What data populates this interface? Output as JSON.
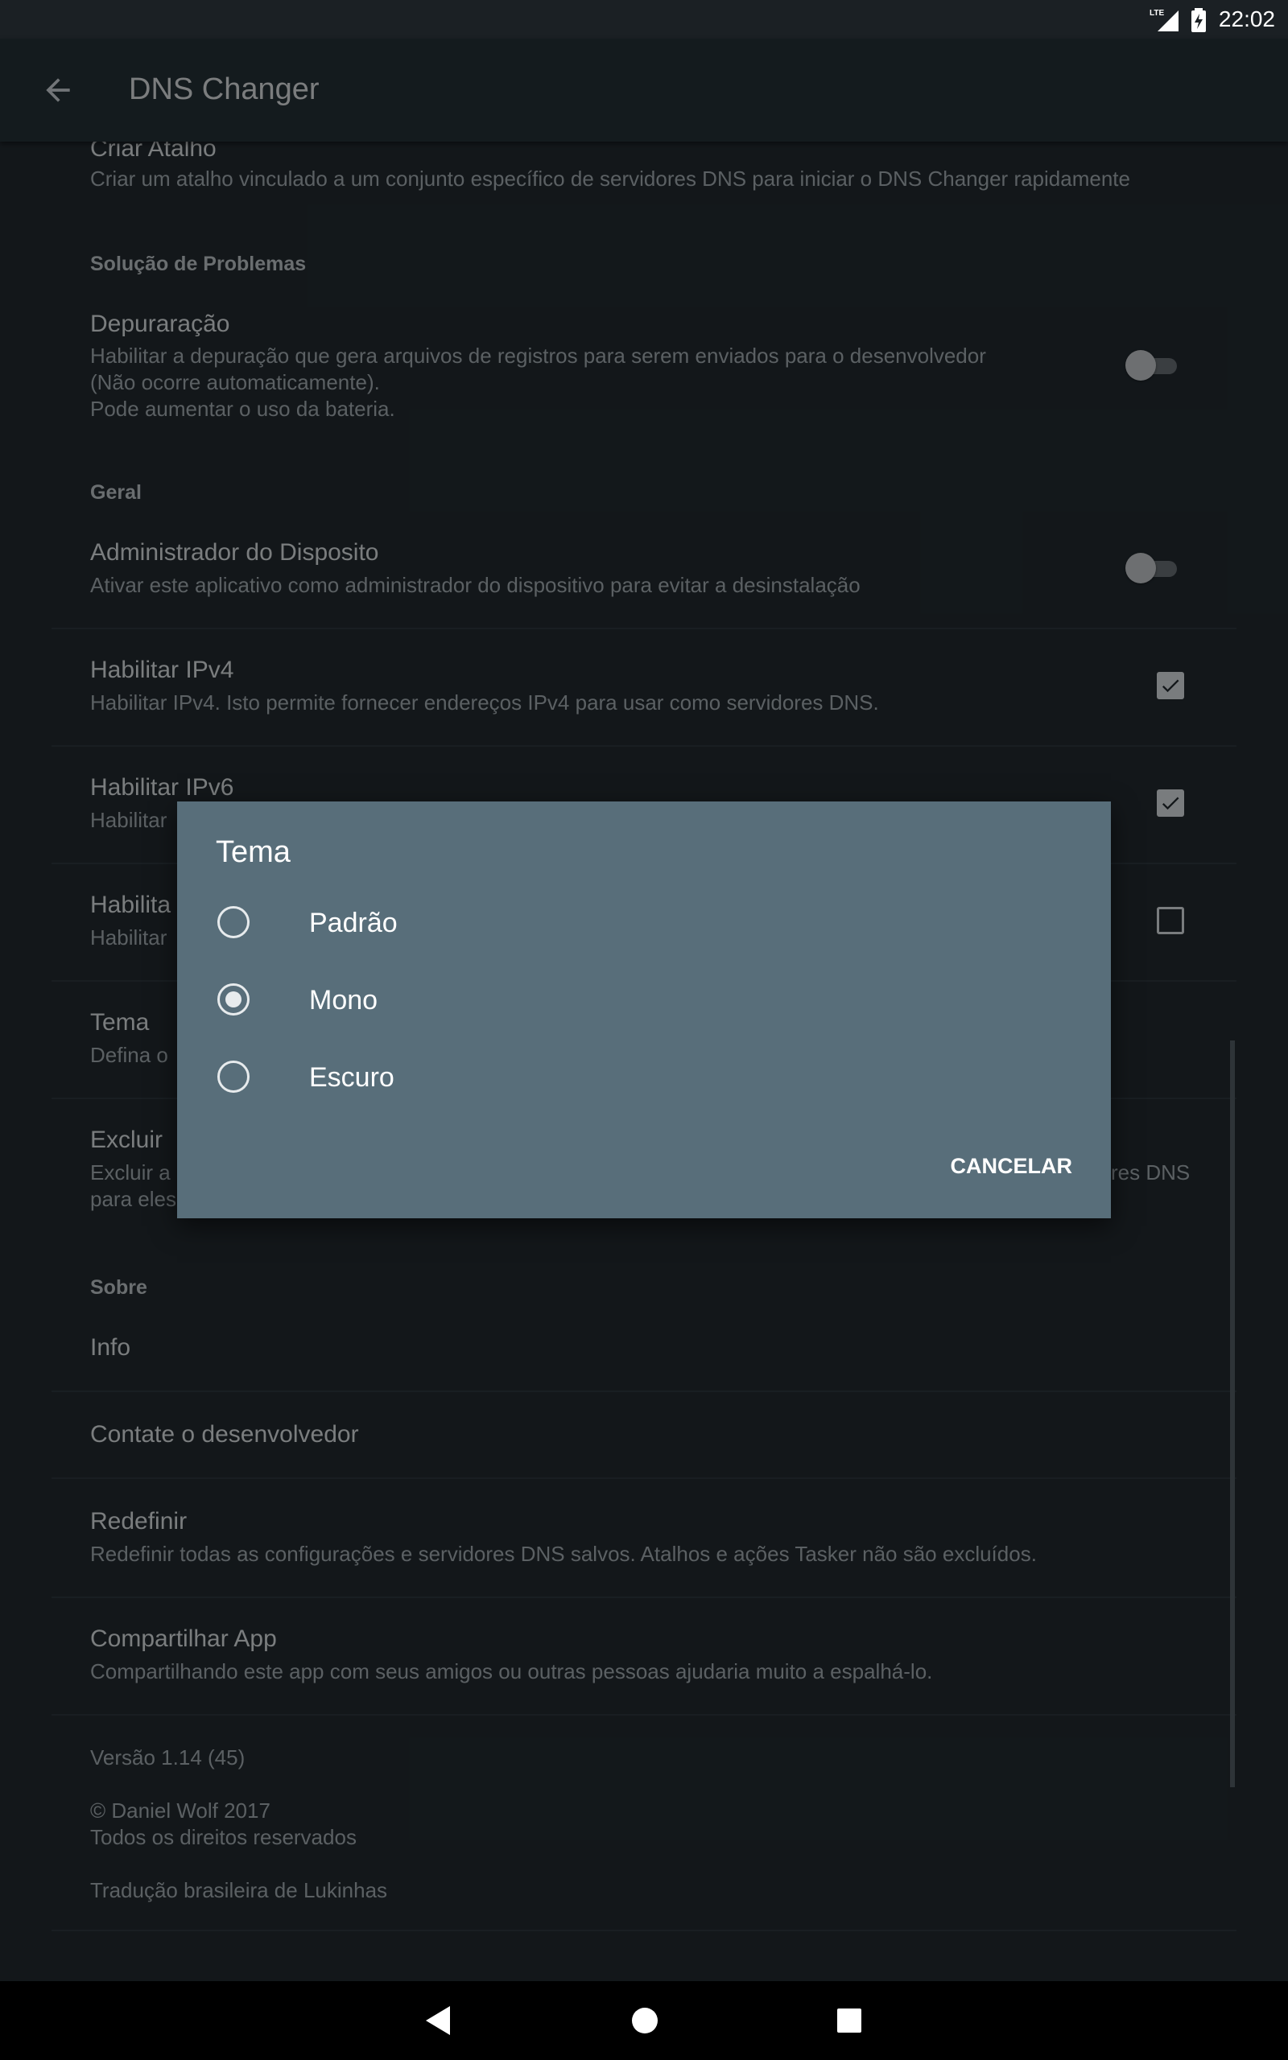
{
  "status_bar": {
    "time": "22:02",
    "network": "LTE"
  },
  "app_bar": {
    "title": "DNS Changer"
  },
  "settings": {
    "shortcut": {
      "title": "Criar Atalho",
      "summary": "Criar um atalho vinculado a um conjunto específico de servidores DNS para iniciar o DNS Changer rapidamente"
    },
    "troubleshooting_header": "Solução de Problemas",
    "debug": {
      "title": "Depuraração",
      "summary": [
        "Habilitar a depuração que gera arquivos de registros para serem enviados para o desenvolvedor",
        "(Não ocorre automaticamente).",
        "Pode aumentar o uso da bateria."
      ],
      "enabled": false
    },
    "general_header": "Geral",
    "device_admin": {
      "title": "Administrador do Disposito",
      "summary": "Ativar este aplicativo como administrador do dispositivo para evitar a desinstalação",
      "enabled": false
    },
    "ipv4": {
      "title": "Habilitar IPv4",
      "summary": "Habilitar IPv4. Isto permite fornecer endereços IPv4 para usar como servidores DNS.",
      "checked": true
    },
    "ipv6": {
      "title": "Habilitar IPv6",
      "summary": "Habilitar",
      "checked": true
    },
    "item3": {
      "title": "Habilita",
      "summary": "Habilitar",
      "checked": false
    },
    "theme": {
      "title": "Tema",
      "summary": "Defina o"
    },
    "exclude": {
      "title": "Excluir",
      "summary": [
        "Excluir a",
        "para eles"
      ],
      "summary_right": "res DNS"
    },
    "about_header": "Sobre",
    "info": {
      "title": "Info"
    },
    "contact": {
      "title": "Contate o desenvolvedor"
    },
    "reset": {
      "title": "Redefinir",
      "summary": "Redefinir todas as configurações e servidores DNS salvos. Atalhos e ações Tasker não são excluídos."
    },
    "share": {
      "title": "Compartilhar App",
      "summary": "Compartilhando este app com seus amigos ou outras pessoas ajudaria muito a espalhá-lo."
    },
    "footer": {
      "version": "Versão 1.14 (45)",
      "copyright": "© Daniel Wolf 2017",
      "rights": "Todos os direitos reservados",
      "translation": "Tradução brasileira de Lukinhas"
    }
  },
  "dialog": {
    "title": "Tema",
    "options": [
      {
        "label": "Padrão",
        "selected": false
      },
      {
        "label": "Mono",
        "selected": true
      },
      {
        "label": "Escuro",
        "selected": false
      }
    ],
    "cancel_label": "CANCELAR"
  },
  "icons": {
    "back": "arrow-back-icon",
    "nav": [
      "nav-back-icon",
      "nav-home-icon",
      "nav-recents-icon"
    ]
  }
}
